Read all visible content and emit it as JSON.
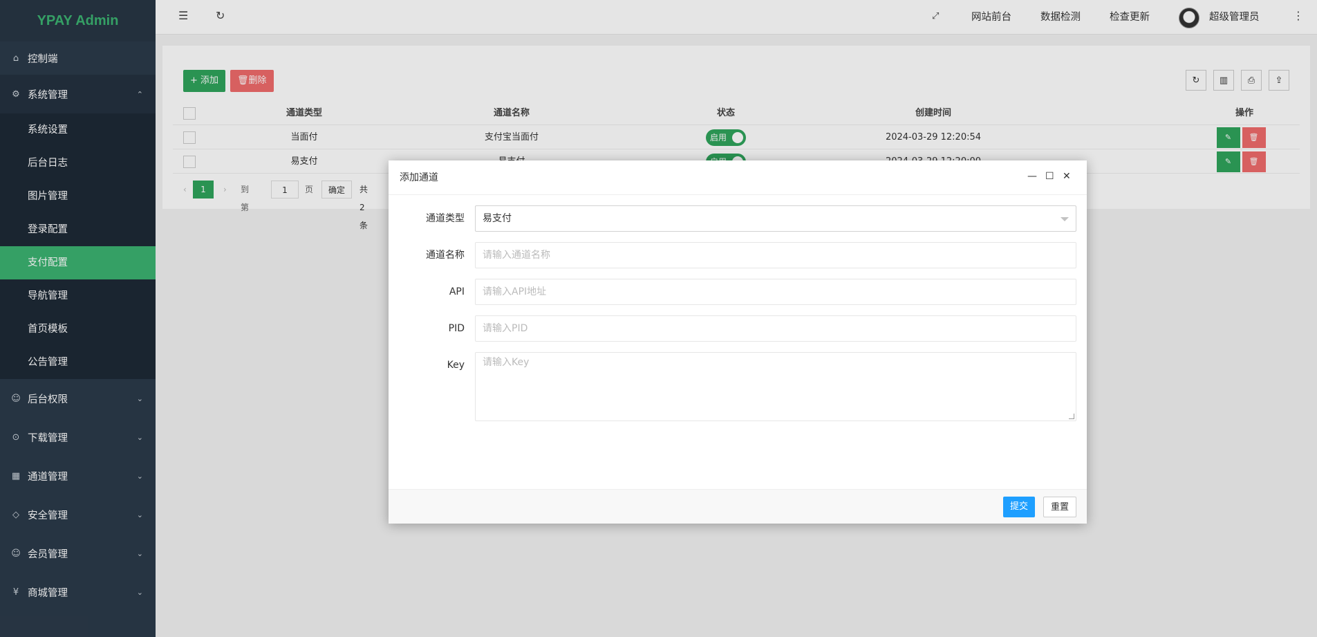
{
  "app": {
    "logo": "YPAY Admin"
  },
  "sidebar": {
    "top": [
      {
        "label": "控制端",
        "icon": "home-icon"
      },
      {
        "label": "系统管理",
        "icon": "gear-icon"
      }
    ],
    "submenu": [
      "系统设置",
      "后台日志",
      "图片管理",
      "登录配置",
      "支付配置",
      "导航管理",
      "首页模板",
      "公告管理"
    ],
    "active_sub": "支付配置",
    "groups": [
      {
        "label": "后台权限",
        "icon": "user-icon"
      },
      {
        "label": "下载管理",
        "icon": "download-icon"
      },
      {
        "label": "通道管理",
        "icon": "apps-icon"
      },
      {
        "label": "安全管理",
        "icon": "diamond-icon"
      },
      {
        "label": "会员管理",
        "icon": "user-icon"
      },
      {
        "label": "商城管理",
        "icon": "yen-icon"
      }
    ]
  },
  "header": {
    "links": [
      "网站前台",
      "数据检测",
      "检查更新"
    ],
    "user": "超级管理员"
  },
  "toolbar": {
    "add": "+ 添加",
    "delete": "删除"
  },
  "table": {
    "headers": [
      "通道类型",
      "通道名称",
      "状态",
      "创建时间",
      "操作"
    ],
    "rows": [
      {
        "type": "当面付",
        "name": "支付宝当面付",
        "status": "启用",
        "time": "2024-03-29 12:20:54"
      },
      {
        "type": "易支付",
        "name": "易支付",
        "status": "启用",
        "time": "2024-03-29 12:20:00"
      }
    ]
  },
  "pager": {
    "current": "1",
    "goto": "到第",
    "page_input": "1",
    "page_unit": "页",
    "confirm": "确定",
    "total": "共 2 条"
  },
  "modal": {
    "title": "添加通道",
    "fields": [
      {
        "label": "通道类型",
        "value": "易支付"
      },
      {
        "label": "通道名称",
        "placeholder": "请输入通道名称"
      },
      {
        "label": "API",
        "placeholder": "请输入API地址"
      },
      {
        "label": "PID",
        "placeholder": "请输入PID"
      },
      {
        "label": "Key",
        "placeholder": "请输入Key"
      }
    ],
    "submit": "提交",
    "reset": "重置"
  },
  "colors": {
    "brand": "#3cb371",
    "sidebar": "#2b3a4a",
    "primary": "#1e9fff",
    "danger": "#f06b6b",
    "success": "#2fa45c"
  }
}
